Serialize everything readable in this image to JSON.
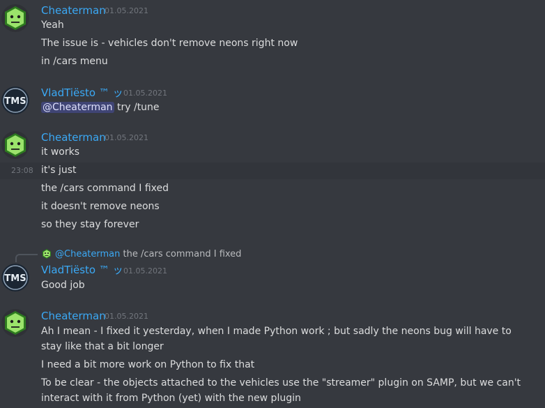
{
  "messages": [
    {
      "author": "Cheaterman",
      "timestamp": "01.05.2021",
      "lines": [
        "Yeah",
        "The issue is - vehicles don't remove neons right now",
        "in /cars menu"
      ]
    },
    {
      "author": "VladTiësto ™ ッ",
      "timestamp": "01.05.2021",
      "mention": "@Cheaterman",
      "text": " try /tune"
    },
    {
      "author": "Cheaterman",
      "timestamp": "01.05.2021",
      "lines": [
        "it works",
        "it's just",
        "the /cars command I fixed",
        "it doesn't remove neons",
        "so they stay forever"
      ],
      "hover_time": "23:08"
    },
    {
      "reply_mention": "@Cheaterman",
      "reply_text": " the /cars command I fixed",
      "author": "VladTiësto ™ ッ",
      "timestamp": "01.05.2021",
      "lines": [
        "Good job"
      ]
    },
    {
      "author": "Cheaterman",
      "timestamp": "01.05.2021",
      "lines": [
        "Ah I mean - I fixed it yesterday, when I made Python work ; but sadly the neons bug will have to stay like that a bit longer",
        "I need a bit more work on Python to fix that",
        "To be clear - the objects attached to the vehicles use the \"streamer\" plugin on SAMP, but we can't interact with it from Python (yet) with the new plugin"
      ]
    }
  ],
  "colors": {
    "background": "#36393f",
    "username": "#3ba9f5",
    "text": "#dcddde",
    "timestamp": "#72767d",
    "cheaterman_avatar_bg": "#3ba55c",
    "hover_row": "#32353b"
  },
  "icons": {
    "cheaterman_avatar": "green-hexagon-face-avatar",
    "vlad_avatar": "tms-logo-avatar"
  }
}
